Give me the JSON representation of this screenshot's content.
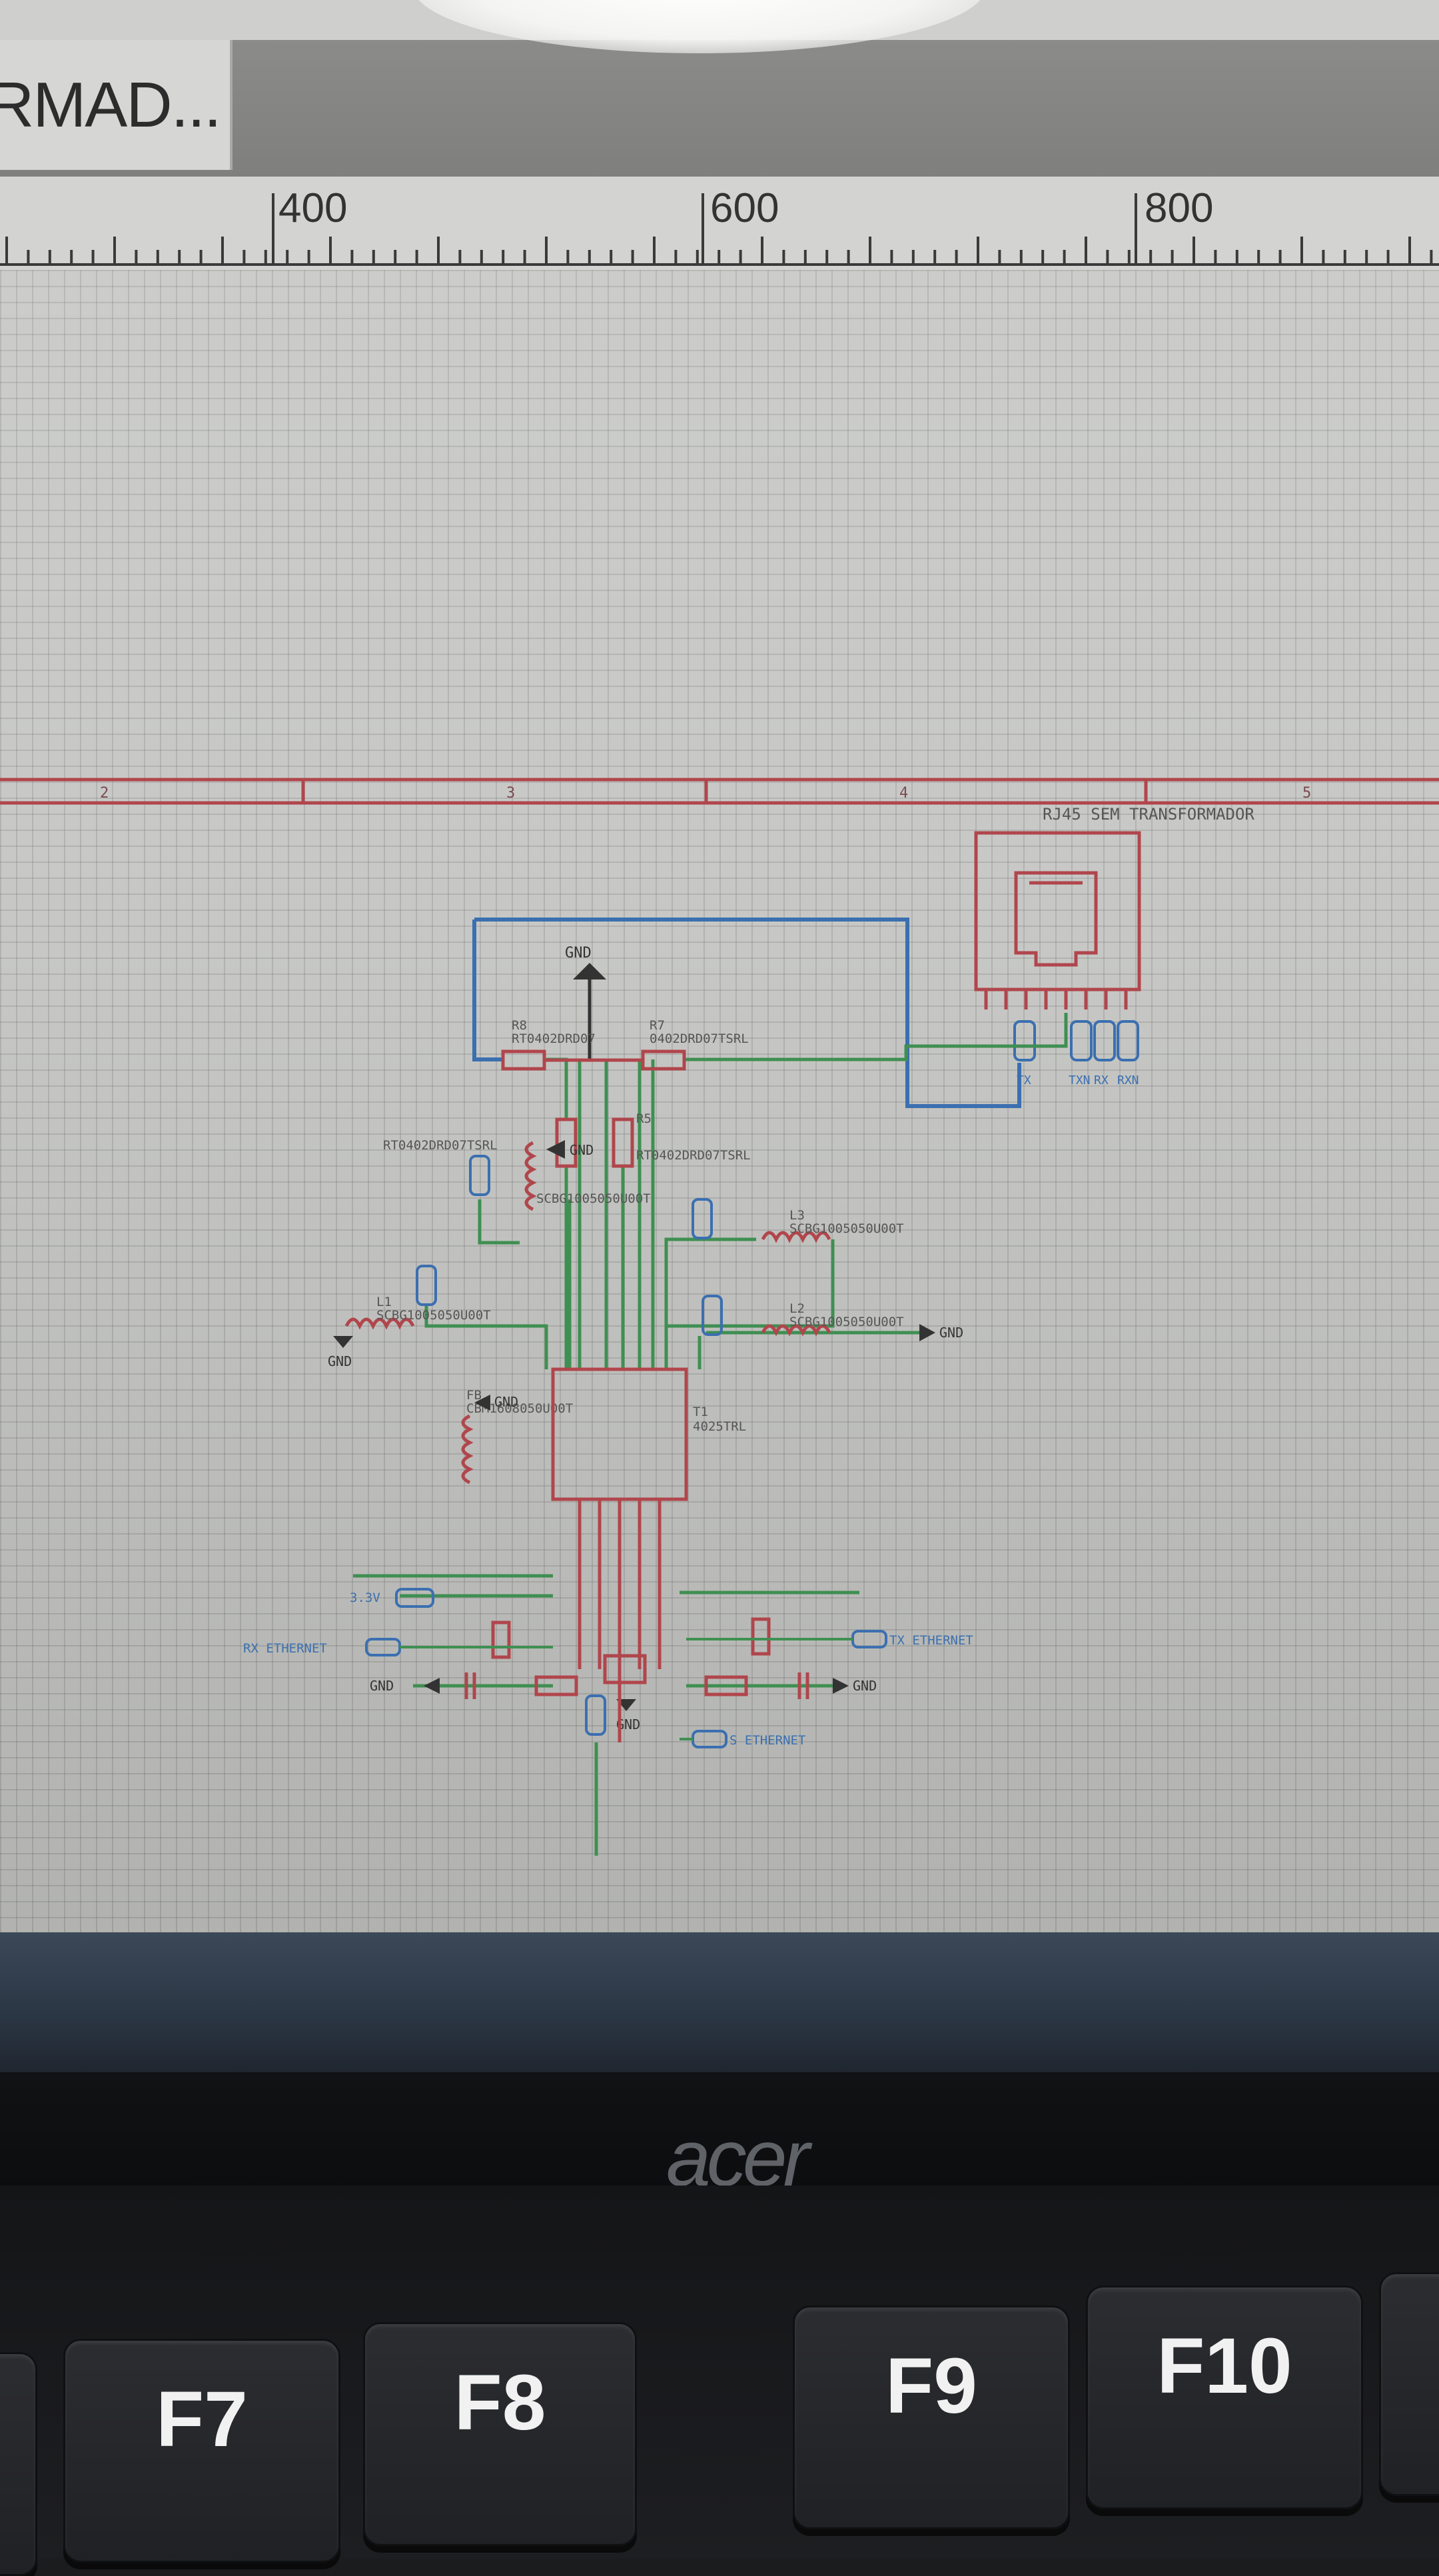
{
  "window": {
    "tab_label": "RMAD..."
  },
  "ruler": {
    "labels": [
      "400",
      "600",
      "800"
    ]
  },
  "schematic": {
    "connector_title": "RJ45 SEM TRANSFORMADOR",
    "frame_zone_numbers": [
      "2",
      "3",
      "4",
      "5"
    ],
    "labels": {
      "gnd": "GND",
      "r8": "R8",
      "r8_value": "RT0402DRD07",
      "r7": "R7",
      "r7_value": "0402DRD07TSRL",
      "r6_value": "RT0402DRD07TSRL",
      "r5": "R5",
      "r5_value": "RT0402DRD07TSRL",
      "l3": "L3",
      "l3_value": "SCBG1005050U00T",
      "l2": "L2",
      "l2_value": "SCBG1005050U00T",
      "l1": "L1",
      "l1_value": "SCBG1005050U00T",
      "l4_value": "SCBG1005050U00T",
      "fb_label": "FB",
      "fb_value": "CBM1608050U00T",
      "transformer": "T1",
      "transformer_value": "4025TRL",
      "port_tx": "TX",
      "port_txn": "TXN",
      "port_rx": "RX",
      "port_rxn": "RXN",
      "port_3v3": "3.3V",
      "port_rx_ethernet": "RX ETHERNET",
      "port_tx_ethernet": "TX ETHERNET",
      "port_s_ethernet": "S ETHERNET"
    }
  },
  "keyboard": {
    "brand": "acer",
    "keys": [
      "F7",
      "F8",
      "F9",
      "F10"
    ]
  }
}
